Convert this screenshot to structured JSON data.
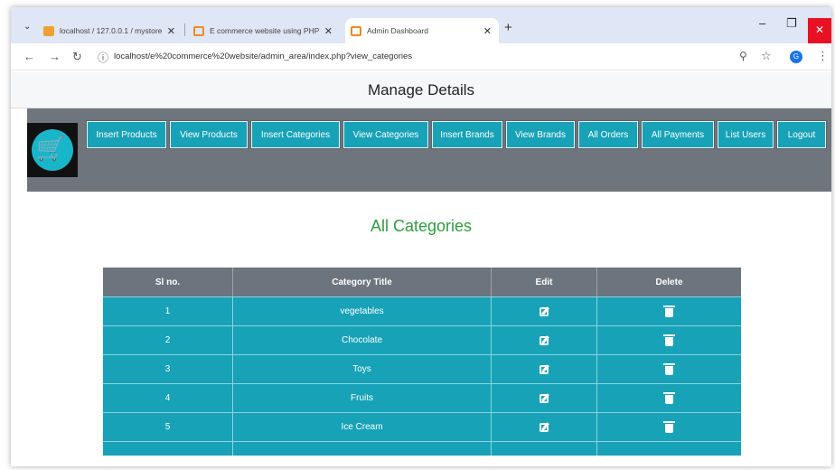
{
  "browser": {
    "tabs": [
      {
        "title": "localhost / 127.0.0.1 / mystore"
      },
      {
        "title": "E commerce website using PHP"
      },
      {
        "title": "Admin Dashboard"
      }
    ],
    "url": "localhost/e%20commerce%20website/admin_area/index.php?view_categories",
    "profile_initial": "G"
  },
  "page": {
    "title": "Manage Details",
    "nav_buttons": [
      "Insert Products",
      "View Products",
      "Insert Categories",
      "View Categories",
      "Insert Brands",
      "View Brands",
      "All Orders",
      "All Payments",
      "List Users",
      "Logout"
    ],
    "section_title": "All Categories"
  },
  "table": {
    "headers": [
      "Sl no.",
      "Category Title",
      "Edit",
      "Delete"
    ],
    "rows": [
      {
        "sl": "1",
        "title": "vegetables"
      },
      {
        "sl": "2",
        "title": "Chocolate"
      },
      {
        "sl": "3",
        "title": "Toys"
      },
      {
        "sl": "4",
        "title": "Fruits"
      },
      {
        "sl": "5",
        "title": "Ice Cream"
      }
    ]
  },
  "colors": {
    "accent": "#17a2b8",
    "nav_band": "#6e757c",
    "header": "#6c757d",
    "section_title": "#2f9a3e"
  }
}
